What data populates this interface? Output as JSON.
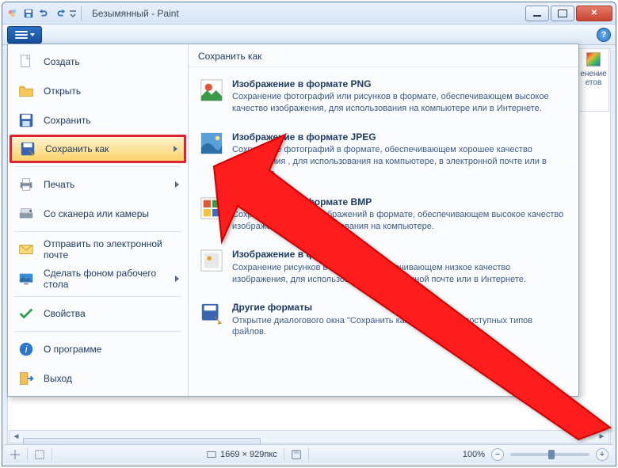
{
  "window": {
    "title": "Безымянный - Paint"
  },
  "right_peek": {
    "label": "енение\nетов"
  },
  "menu": {
    "items": [
      {
        "label": "Создать"
      },
      {
        "label": "Открыть"
      },
      {
        "label": "Сохранить"
      },
      {
        "label": "Сохранить как",
        "selected": true,
        "has_submenu": true
      },
      {
        "label": "Печать",
        "has_submenu": true
      },
      {
        "label": "Со сканера или камеры"
      },
      {
        "label": "Отправить по электронной почте"
      },
      {
        "label": "Сделать фоном рабочего стола",
        "has_submenu": true
      },
      {
        "label": "Свойства"
      },
      {
        "label": "О программе"
      },
      {
        "label": "Выход"
      }
    ]
  },
  "submenu": {
    "title": "Сохранить как",
    "items": [
      {
        "hd": "Изображение в формате PNG",
        "ds": "Сохранение фотографий или рисунков в формате, обеспечивающем высокое качество изображения, для использования на компьютере или в Интернете."
      },
      {
        "hd": "Изображение в формате JPEG",
        "ds": "Сохранение фотографий в формате, обеспечивающем хорошее качество изображения , для использования на компьютере, в электронной почте или в Интернете."
      },
      {
        "hd": "Изображение в формате BMP",
        "ds": "Сохранение любых изображений в формате, обеспечивающем высокое качество изображения, для использования на компьютере."
      },
      {
        "hd": "Изображение в формате GIF",
        "ds": "Сохранение рисунков в формате, обеспечивающем низкое качество изображения, для использования в электронной почте или в Интернете."
      },
      {
        "hd": "Другие форматы",
        "ds": "Открытие диалогового окна \"Сохранить как\" для выбора доступных типов файлов."
      }
    ]
  },
  "status": {
    "dimensions": "1669 × 929пкс",
    "zoom": "100%",
    "minus": "−",
    "plus": "+"
  }
}
